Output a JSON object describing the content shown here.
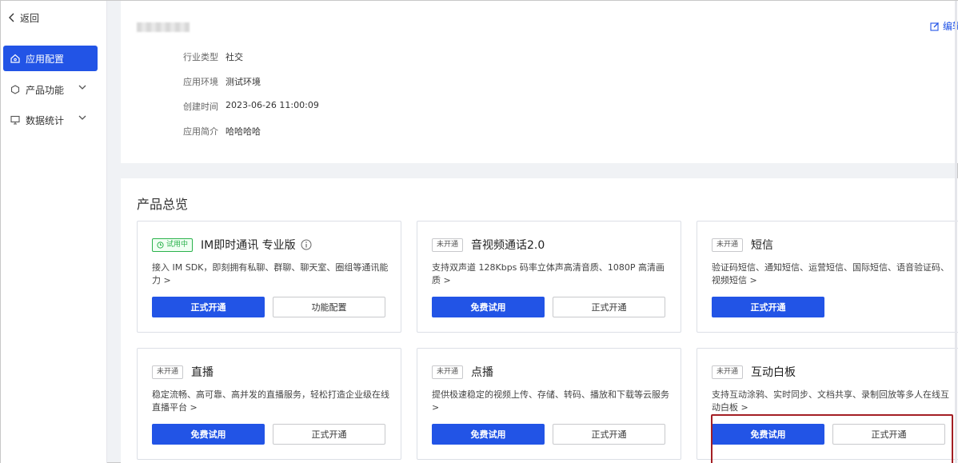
{
  "sidebar": {
    "back_label": "返回",
    "items": [
      {
        "label": "应用配置",
        "icon": "home-config-icon",
        "active": true
      },
      {
        "label": "产品功能",
        "icon": "hexagon-icon",
        "active": false
      },
      {
        "label": "数据统计",
        "icon": "monitor-icon",
        "active": false
      }
    ]
  },
  "info": {
    "edit_label": "编辑",
    "rows": [
      {
        "key": "行业类型",
        "value": "社交"
      },
      {
        "key": "应用环境",
        "value": "测试环境"
      },
      {
        "key": "创建时间",
        "value": "2023-06-26 11:00:09"
      },
      {
        "key": "应用简介",
        "value": "哈哈哈哈"
      }
    ]
  },
  "overview": {
    "title": "产品总览",
    "cards": [
      {
        "tag": "试用中",
        "name": "IM即时通讯 专业版",
        "desc": "接入 IM SDK，即刻拥有私聊、群聊、聊天室、圈组等通讯能力 >",
        "primary": "正式开通",
        "secondary": "功能配置"
      },
      {
        "tag": "未开通",
        "name": "音视频通话2.0",
        "desc": "支持双声道 128Kbps 码率立体声高清音质、1080P 高清画质 >",
        "primary": "免费试用",
        "secondary": "正式开通"
      },
      {
        "tag": "未开通",
        "name": "短信",
        "desc": "验证码短信、通知短信、运营短信、国际短信、语音验证码、视频短信 >",
        "primary": "正式开通",
        "secondary": ""
      },
      {
        "tag": "未开通",
        "name": "直播",
        "desc": "稳定流畅、高可靠、高并发的直播服务，轻松打造企业级在线直播平台 >",
        "primary": "免费试用",
        "secondary": "正式开通"
      },
      {
        "tag": "未开通",
        "name": "点播",
        "desc": "提供极速稳定的视频上传、存储、转码、播放和下载等云服务 >",
        "primary": "免费试用",
        "secondary": "正式开通"
      },
      {
        "tag": "未开通",
        "name": "互动白板",
        "desc": "支持互动涂鸦、实时同步、文档共享、录制回放等多人在线互动白板 >",
        "primary": "免费试用",
        "secondary": "正式开通"
      }
    ]
  },
  "colors": {
    "accent": "#2254e6",
    "trial_green": "#2bb24c",
    "highlight": "#a31f24"
  }
}
